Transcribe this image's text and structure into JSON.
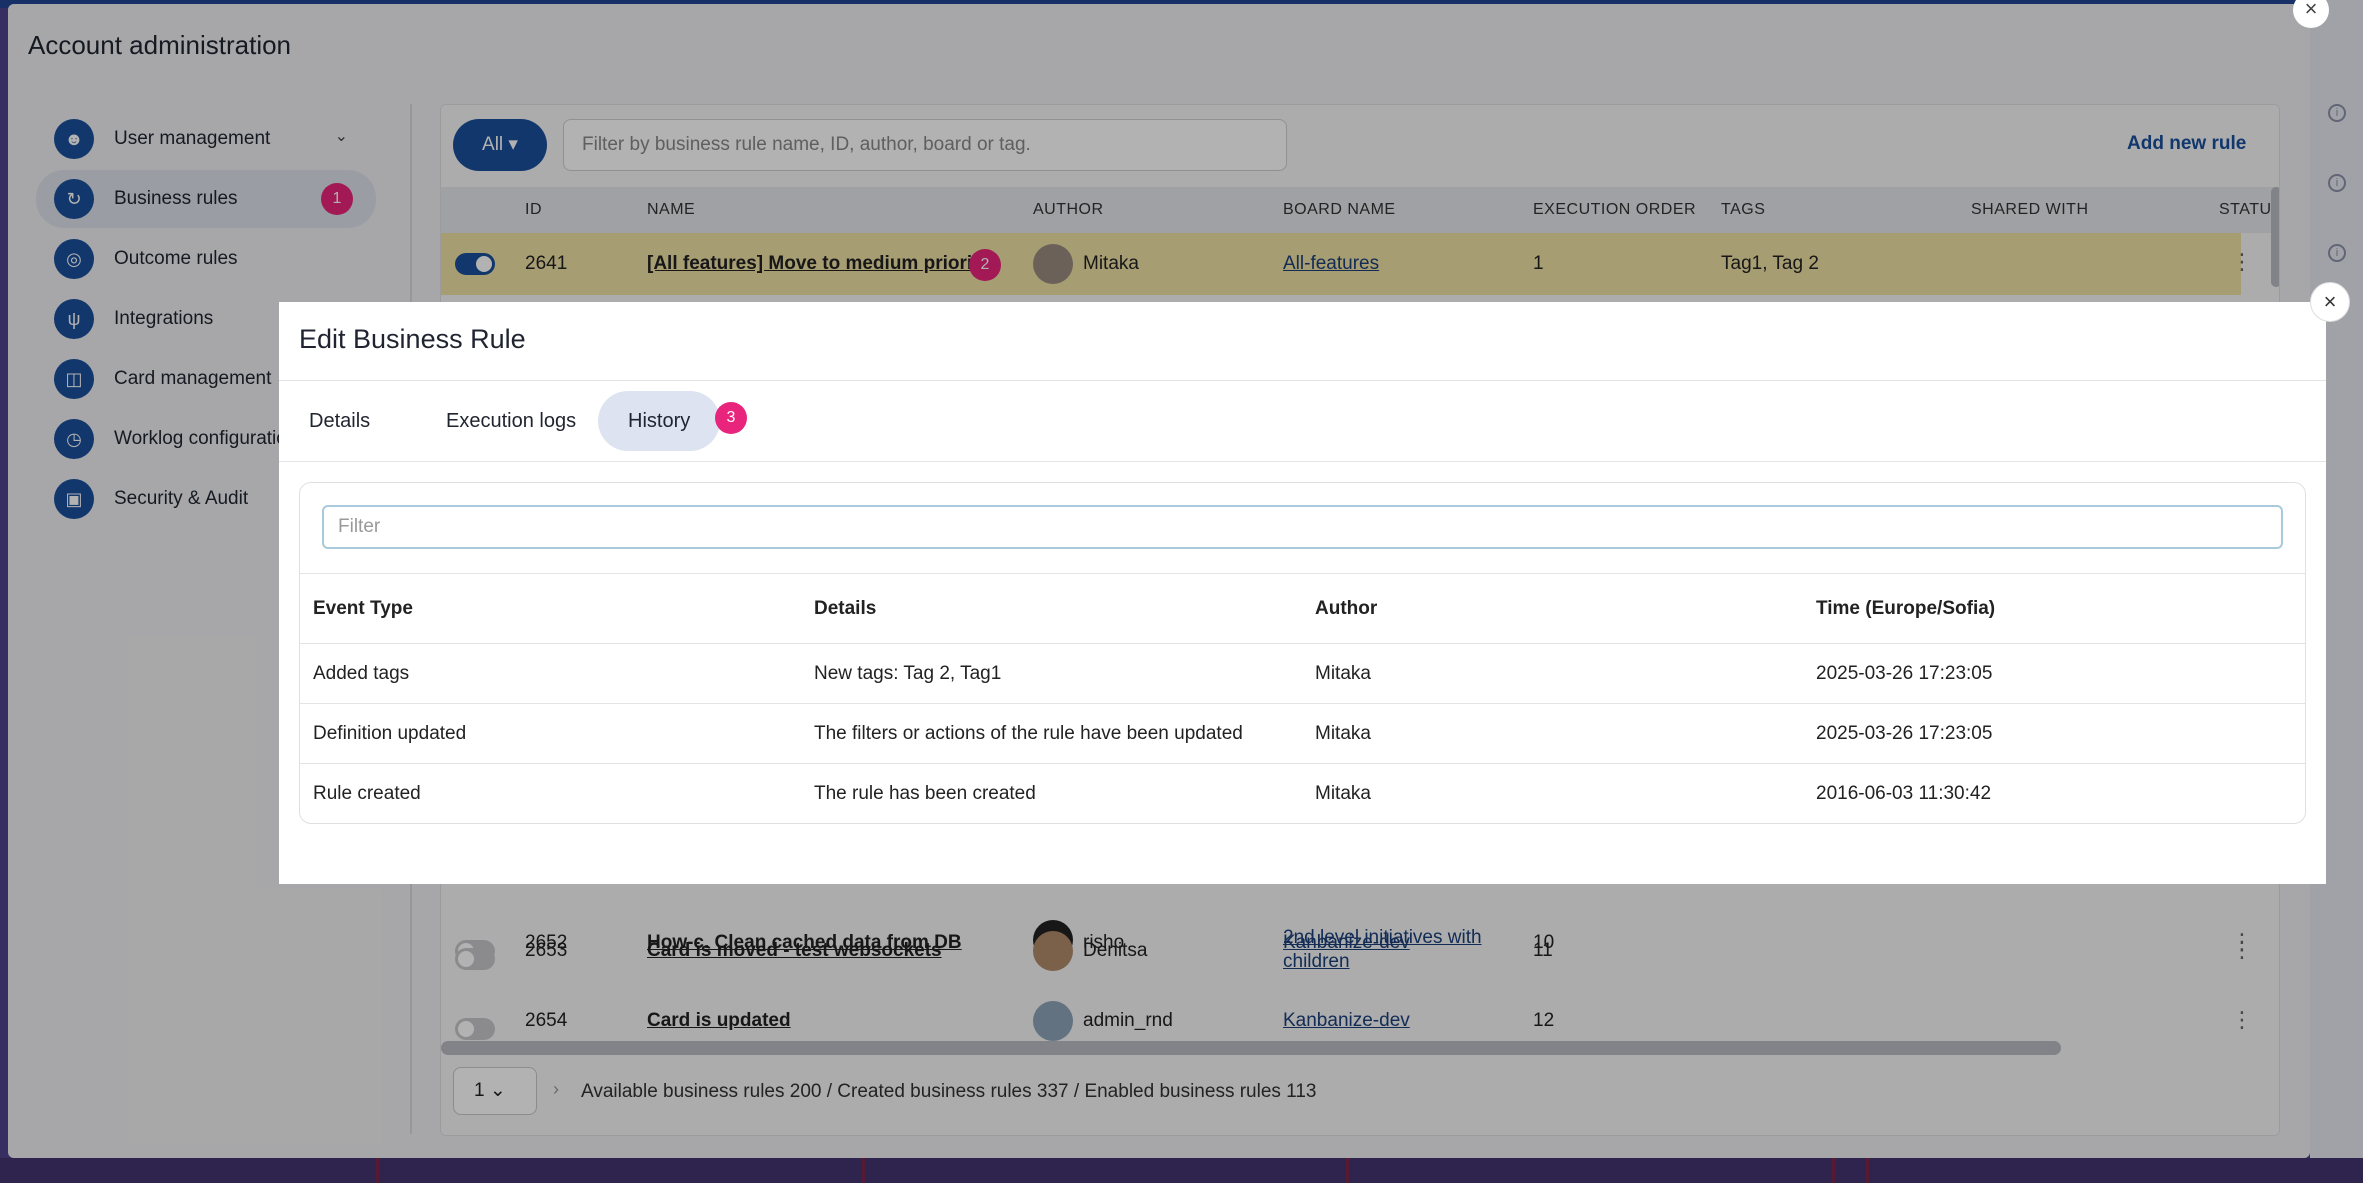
{
  "admin": {
    "title": "Account administration",
    "close_icon": "close-icon",
    "sidebar": [
      {
        "label": "User management",
        "icon": "users-icon",
        "chevron": "⌄"
      },
      {
        "label": "Business rules",
        "icon": "refresh-icon",
        "badge": "1"
      },
      {
        "label": "Outcome rules",
        "icon": "target-icon"
      },
      {
        "label": "Integrations",
        "icon": "plug-icon"
      },
      {
        "label": "Card management",
        "icon": "cards-icon"
      },
      {
        "label": "Worklog configuratio",
        "icon": "worklog-icon"
      },
      {
        "label": "Security & Audit",
        "icon": "lock-icon"
      }
    ]
  },
  "rules": {
    "all_label": "All ▾",
    "search_placeholder": "Filter by business rule name, ID, author, board or tag.",
    "add_label": "Add new rule",
    "columns": [
      "ID",
      "NAME",
      "AUTHOR",
      "BOARD NAME",
      "EXECUTION ORDER",
      "TAGS",
      "SHARED WITH",
      "STATUS"
    ],
    "rows": [
      {
        "id": "2641",
        "name": "[All features] Move to medium priorit",
        "author": "Mitaka",
        "board": "All-features",
        "order": "1",
        "tags": "Tag1, Tag 2",
        "enabled": true
      },
      {
        "id": "2652",
        "name": "How-c. Clean cached data from DB",
        "author": "risho",
        "board": "Kanbanize-dev",
        "order": "10",
        "tags": "",
        "enabled": false
      },
      {
        "id": "2653",
        "name": "Card is moved - test websockets",
        "author": "Denitsa",
        "board": "2nd level initiatives with",
        "board2": "children",
        "order": "11",
        "tags": "",
        "enabled": false
      },
      {
        "id": "2654",
        "name": "Card is updated",
        "author": "admin_rnd",
        "board": "Kanbanize-dev",
        "order": "12",
        "tags": "",
        "enabled": false
      }
    ],
    "name_badge": "2",
    "pager_value": "1",
    "pager_info": "Available business rules 200 / Created business rules 337 / Enabled business rules 113"
  },
  "modal": {
    "title": "Edit Business Rule",
    "tabs": [
      "Details",
      "Execution logs",
      "History"
    ],
    "tab_badge": "3",
    "filter_placeholder": "Filter",
    "columns": [
      "Event Type",
      "Details",
      "Author",
      "Time (Europe/Sofia)"
    ],
    "rows": [
      {
        "event": "Added tags",
        "details": "New tags: Tag 2, Tag1",
        "author": "Mitaka",
        "time": "2025-03-26 17:23:05"
      },
      {
        "event": "Definition updated",
        "details": "The filters or actions of the rule have been updated",
        "author": "Mitaka",
        "time": "2025-03-26 17:23:05"
      },
      {
        "event": "Rule created",
        "details": "The rule has been created",
        "author": "Mitaka",
        "time": "2016-06-03 11:30:42"
      }
    ]
  },
  "colors": {
    "accent": "#1a4f9c",
    "badge": "#e8247c",
    "highlight": "#efe1a5"
  }
}
